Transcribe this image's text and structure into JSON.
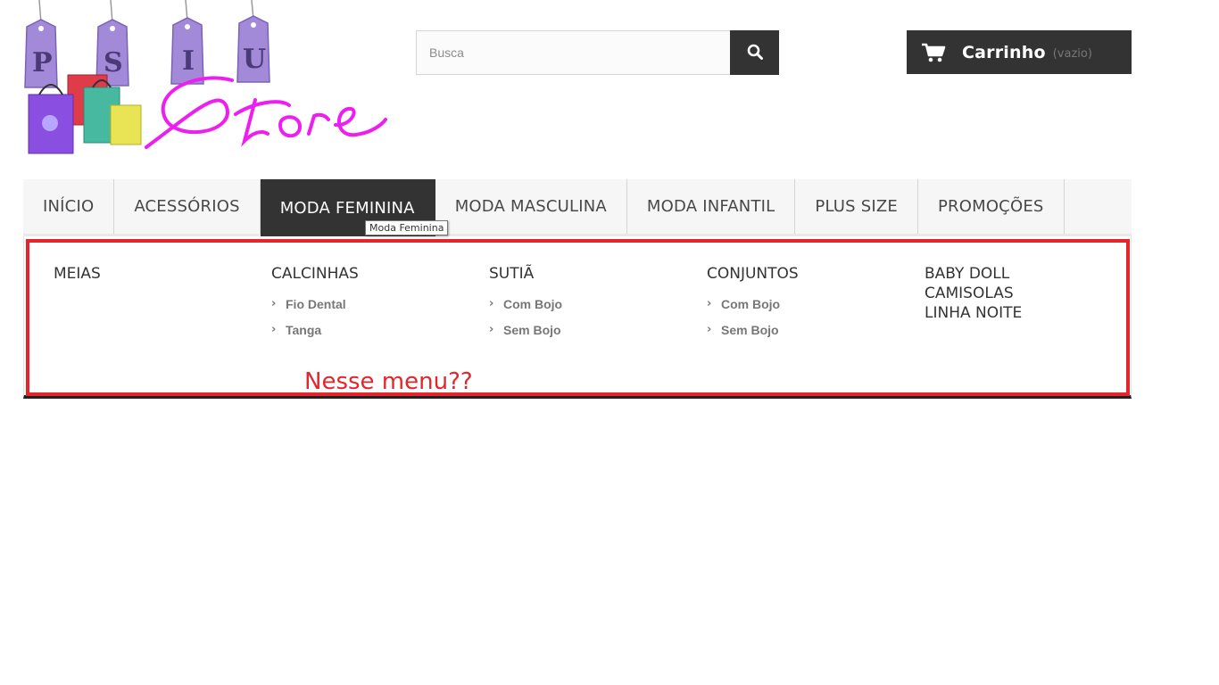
{
  "header": {
    "logo_text": "PSIU Store",
    "search": {
      "placeholder": "Busca",
      "value": ""
    },
    "cart": {
      "label": "Carrinho",
      "status": "(vazio)"
    }
  },
  "nav": {
    "items": [
      {
        "label": "INÍCIO"
      },
      {
        "label": "ACESSÓRIOS"
      },
      {
        "label": "MODA FEMININA",
        "active": true
      },
      {
        "label": "MODA MASCULINA"
      },
      {
        "label": "MODA INFANTIL"
      },
      {
        "label": "PLUS SIZE"
      },
      {
        "label": "PROMOÇÕES"
      }
    ],
    "tooltip": "Moda Feminina"
  },
  "dropdown": {
    "columns": [
      {
        "heading": "MEIAS",
        "items": []
      },
      {
        "heading": "CALCINHAS",
        "items": [
          "Fio Dental",
          "Tanga"
        ]
      },
      {
        "heading": "SUTIÃ",
        "items": [
          "Com Bojo",
          "Sem Bojo"
        ]
      },
      {
        "heading": "CONJUNTOS",
        "items": [
          "Com Bojo",
          "Sem Bojo"
        ]
      },
      {
        "headings": [
          "BABY DOLL",
          "CAMISOLAS",
          "LINHA NOITE"
        ]
      }
    ]
  },
  "annotation": {
    "text": "Nesse menu??"
  },
  "colors": {
    "dark": "#333333",
    "annotation_red": "#e4262c",
    "logo_magenta": "#ee1ef0",
    "tag_purple": "#9b7fd4"
  },
  "icons": {
    "search": "search-icon",
    "cart": "cart-icon",
    "chevron": "chevron-right-icon"
  }
}
